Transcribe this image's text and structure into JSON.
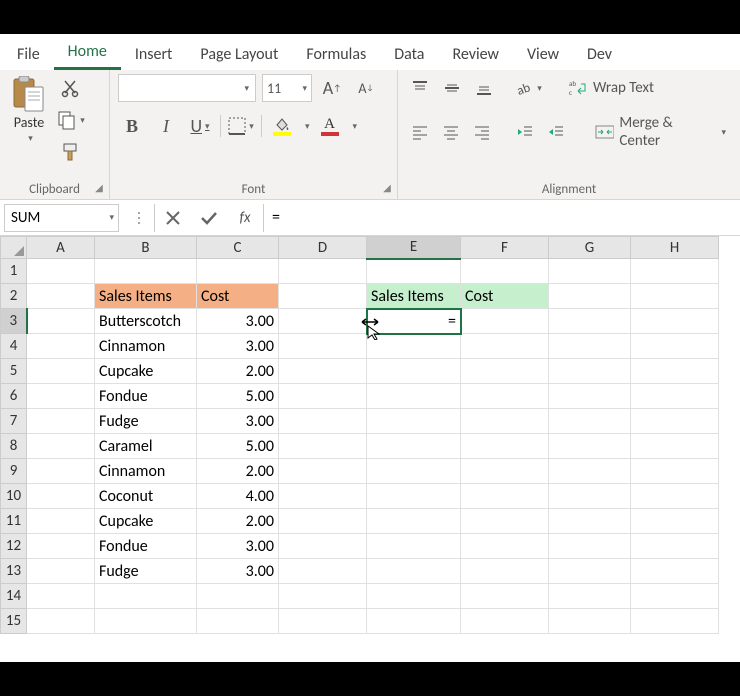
{
  "tabs": {
    "file": "File",
    "home": "Home",
    "insert": "Insert",
    "page_layout": "Page Layout",
    "formulas": "Formulas",
    "data": "Data",
    "review": "Review",
    "view": "View",
    "dev": "Dev"
  },
  "ribbon": {
    "clipboard": {
      "label": "Clipboard",
      "paste": "Paste"
    },
    "font": {
      "label": "Font",
      "name": "",
      "size": "11",
      "bold": "B",
      "italic": "I",
      "underline": "U",
      "font_color": "#d13438",
      "fill_color": "#ffff00"
    },
    "alignment": {
      "label": "Alignment",
      "wrap": "Wrap Text",
      "merge": "Merge & Center"
    }
  },
  "formula_bar": {
    "name_box": "SUM",
    "fx": "fx",
    "formula": "="
  },
  "grid": {
    "columns": [
      "A",
      "B",
      "C",
      "D",
      "E",
      "F",
      "G",
      "H"
    ],
    "col_widths": {
      "A": 68,
      "B": 102,
      "C": 82,
      "D": 88,
      "E": 94,
      "F": 88,
      "G": 82,
      "H": 88
    },
    "active_col": "E",
    "active_row": 3,
    "rows": [
      1,
      2,
      3,
      4,
      5,
      6,
      7,
      8,
      9,
      10,
      11,
      12,
      13,
      14,
      15
    ],
    "headers_orange": {
      "B2": "Sales Items",
      "C2": "Cost"
    },
    "headers_green": {
      "E2": "Sales Items",
      "F2": "Cost"
    },
    "active_cell_value": "=",
    "data": [
      {
        "item": "Butterscotch",
        "cost": "3.00"
      },
      {
        "item": "Cinnamon",
        "cost": "3.00"
      },
      {
        "item": "Cupcake",
        "cost": "2.00"
      },
      {
        "item": "Fondue",
        "cost": "5.00"
      },
      {
        "item": "Fudge",
        "cost": "3.00"
      },
      {
        "item": "Caramel",
        "cost": "5.00"
      },
      {
        "item": "Cinnamon",
        "cost": "2.00"
      },
      {
        "item": "Coconut",
        "cost": "4.00"
      },
      {
        "item": "Cupcake",
        "cost": "2.00"
      },
      {
        "item": "Fondue",
        "cost": "3.00"
      },
      {
        "item": "Fudge",
        "cost": "3.00"
      }
    ]
  }
}
